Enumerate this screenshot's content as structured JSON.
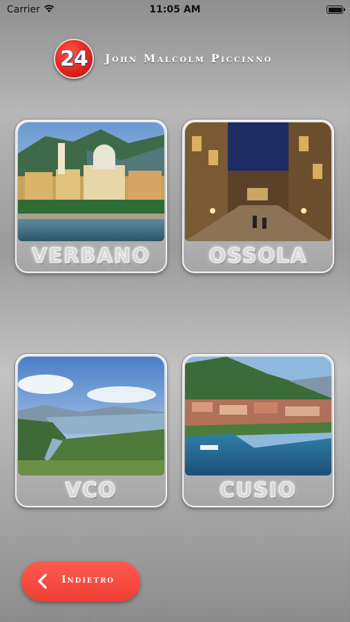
{
  "status_bar": {
    "carrier": "Carrier",
    "time": "11:05 AM"
  },
  "header": {
    "logo_text": "24",
    "title": "John Malcolm Piccinno"
  },
  "tiles": [
    {
      "label": "VERBANO"
    },
    {
      "label": "OSSOLA"
    },
    {
      "label": "VCO"
    },
    {
      "label": "CUSIO"
    }
  ],
  "back_button": {
    "label": "Indietro"
  },
  "colors": {
    "accent": "#ef3f35",
    "text_light": "#ffffff"
  }
}
